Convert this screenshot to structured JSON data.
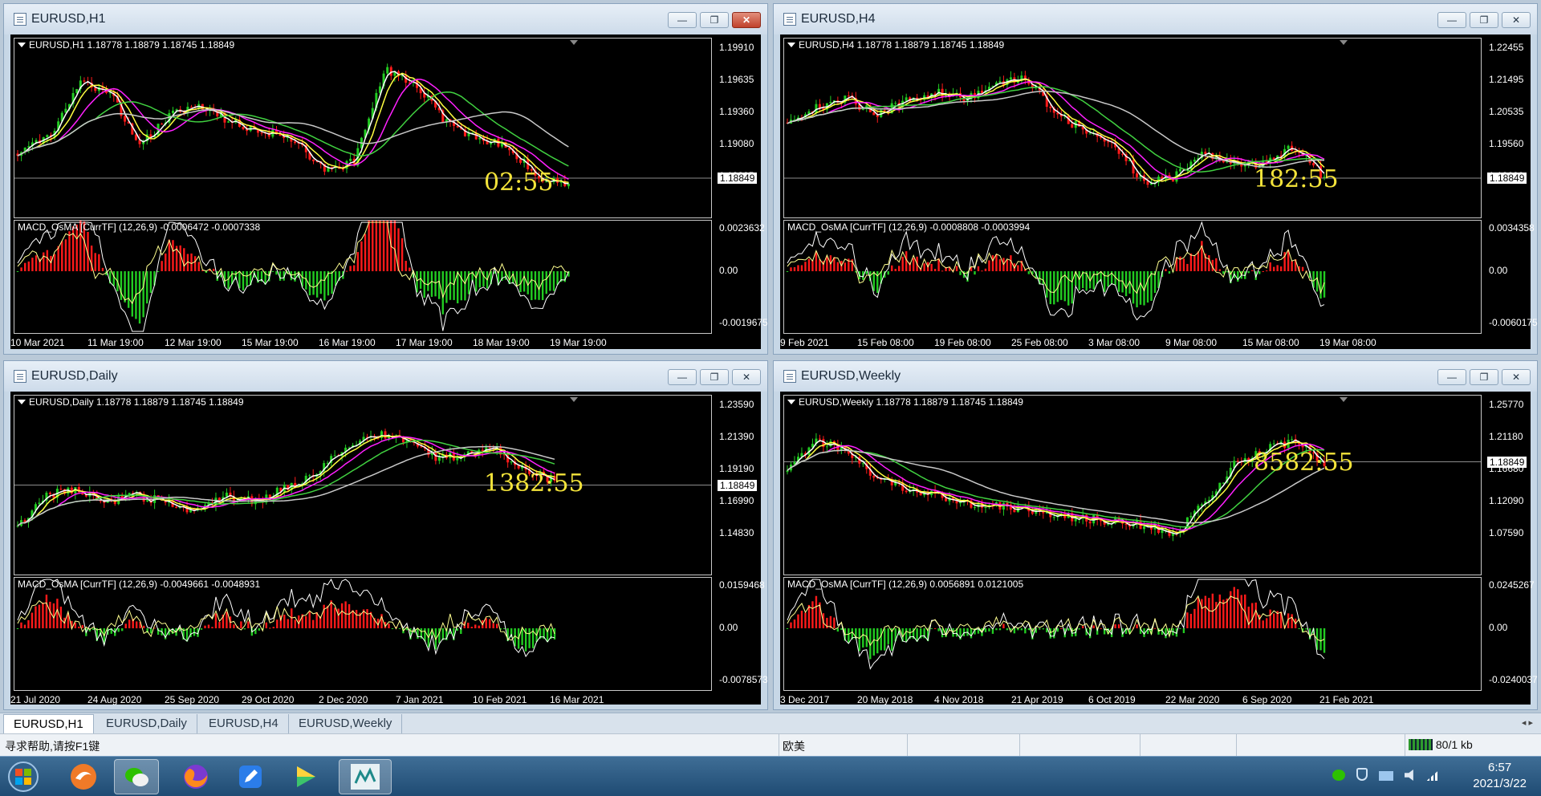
{
  "windows": [
    {
      "id": "h1",
      "title": "EURUSD,H1",
      "close_active": true,
      "legend": "EURUSD,H1  1.18778 1.18879 1.18745 1.18849",
      "macd_legend": "MACD_OsMA [CurrTF] (12,26,9) -0.0006472 -0.0007338",
      "price_axis": [
        "1.19910",
        "1.19635",
        "1.19360",
        "1.19080",
        "1.18805"
      ],
      "current_price": "1.18849",
      "macd_axis": [
        "0.0023632",
        "0.00",
        "-0.0019675"
      ],
      "countdown": "02:55",
      "time_axis": [
        "10 Mar 2021",
        "11 Mar 19:00",
        "12 Mar 19:00",
        "15 Mar 19:00",
        "16 Mar 19:00",
        "17 Mar 19:00",
        "18 Mar 19:00",
        "19 Mar 19:00"
      ]
    },
    {
      "id": "h4",
      "title": "EURUSD,H4",
      "close_active": false,
      "legend": "EURUSD,H4  1.18778 1.18879 1.18745 1.18849",
      "macd_legend": "MACD_OsMA [CurrTF] (12,26,9) -0.0008808 -0.0003994",
      "price_axis": [
        "1.22455",
        "1.21495",
        "1.20535",
        "1.19560",
        "1.18600"
      ],
      "current_price": "1.18849",
      "macd_axis": [
        "0.0034358",
        "0.00",
        "-0.0060175"
      ],
      "countdown": "182:55",
      "time_axis": [
        "9 Feb 2021",
        "15 Feb 08:00",
        "19 Feb 08:00",
        "25 Feb 08:00",
        "3 Mar 08:00",
        "9 Mar 08:00",
        "15 Mar 08:00",
        "19 Mar 08:00"
      ]
    },
    {
      "id": "daily",
      "title": "EURUSD,Daily",
      "close_active": false,
      "legend": "EURUSD,Daily  1.18778 1.18879 1.18745 1.18849",
      "macd_legend": "MACD_OsMA [CurrTF] (12,26,9) -0.0049661 -0.0048931",
      "price_axis": [
        "1.23590",
        "1.21390",
        "1.19190",
        "1.16990",
        "1.14830"
      ],
      "current_price": "1.18849",
      "macd_axis": [
        "0.0159468",
        "0.00",
        "-0.0078573"
      ],
      "countdown": "1382:55",
      "time_axis": [
        "21 Jul 2020",
        "24 Aug 2020",
        "25 Sep 2020",
        "29 Oct 2020",
        "2 Dec 2020",
        "7 Jan 2021",
        "10 Feb 2021",
        "16 Mar 2021"
      ]
    },
    {
      "id": "weekly",
      "title": "EURUSD,Weekly",
      "close_active": false,
      "legend": "EURUSD,Weekly  1.18778 1.18879 1.18745 1.18849",
      "macd_legend": "MACD_OsMA [CurrTF] (12,26,9) 0.0056891 0.0121005",
      "price_axis": [
        "1.25770",
        "1.21180",
        "1.16680",
        "1.12090",
        "1.07590"
      ],
      "current_price": "1.18849",
      "macd_axis": [
        "0.0245267",
        "0.00",
        "-0.0240037"
      ],
      "countdown": "8582:55",
      "time_axis": [
        "3 Dec 2017",
        "20 May 2018",
        "4 Nov 2018",
        "21 Apr 2019",
        "6 Oct 2019",
        "22 Mar 2020",
        "6 Sep 2020",
        "21 Feb 2021"
      ]
    }
  ],
  "window_buttons": {
    "minimize": "—",
    "restore": "❐",
    "close": "✕"
  },
  "tabs": [
    "EURUSD,H1",
    "EURUSD,Daily",
    "EURUSD,H4",
    "EURUSD,Weekly"
  ],
  "tab_scroll": "◂ ▸",
  "status": {
    "help": "寻求帮助,请按F1键",
    "profile": "欧美",
    "connection": "80/1 kb"
  },
  "clock": {
    "time": "6:57",
    "date": "2021/3/22"
  },
  "colors": {
    "bull": "#22cc22",
    "bear": "#ff1a1a",
    "ma_white": "#ffffff",
    "ma_yellow": "#ffff40",
    "ma_magenta": "#ff20ff",
    "ma_green": "#40d040",
    "ma_gray": "#c8c8c8",
    "countdown": "#f3e33a"
  }
}
